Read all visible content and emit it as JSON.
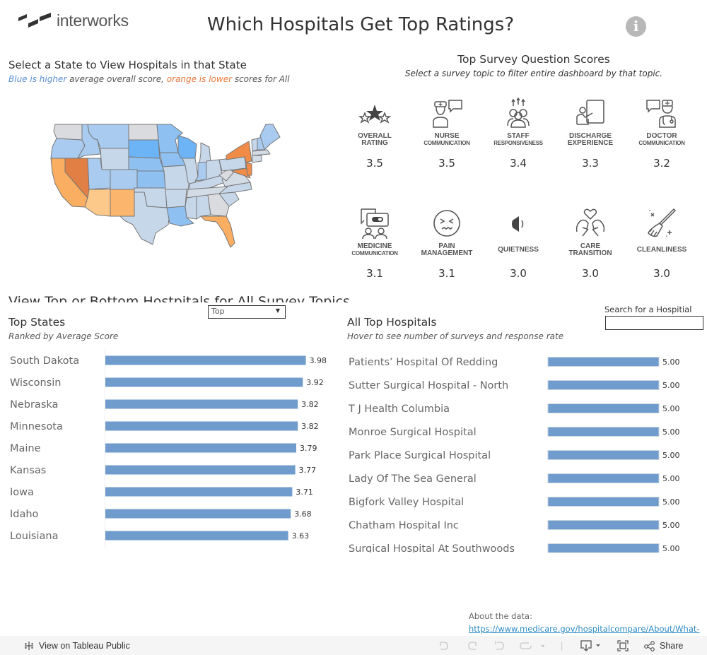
{
  "header": {
    "logo_text": "interworks",
    "title": "Which Hospitals Get Top Ratings?",
    "info_icon": "info-circle-icon"
  },
  "map_section": {
    "title": "Select a State to View Hospitals in that State",
    "legend_blue": "Blue is higher",
    "legend_mid": " average overall score, ",
    "legend_orange": "orange is lower",
    "legend_end": " scores for  All",
    "colors": {
      "highest": "#6db4f7",
      "high": "#8fc0f2",
      "mid_high": "#a9cbf0",
      "neutral": "#c7d7ea",
      "no_data": "#d9dbdf",
      "low": "#fcc98a",
      "lower": "#f9ae62",
      "lowest": "#e27f45",
      "border": "#777777"
    }
  },
  "survey_scores": {
    "title": "Top Survey Question Scores",
    "subtitle": "Select a survey topic to filter entire dashboard by that topic.",
    "topics": [
      {
        "line1": "OVERALL",
        "line2": "RATING",
        "big2": true,
        "score": "3.5",
        "icon": "stars-icon"
      },
      {
        "line1": "NURSE",
        "line2": "COMMUNICATION",
        "big2": false,
        "score": "3.5",
        "icon": "nurse-chat-icon"
      },
      {
        "line1": "STAFF",
        "line2": "RESPONSIVENESS",
        "big2": false,
        "score": "3.4",
        "icon": "staff-arrows-icon"
      },
      {
        "line1": "DISCHARGE",
        "line2": "EXPERIENCE",
        "big2": true,
        "score": "3.3",
        "icon": "discharge-board-icon"
      },
      {
        "line1": "DOCTOR",
        "line2": "COMMUNICATION",
        "big2": false,
        "score": "3.2",
        "icon": "doctor-chat-icon"
      },
      {
        "line1": "MEDICINE",
        "line2": "COMMUNICATION",
        "big2": false,
        "score": "3.1",
        "icon": "medicine-chat-icon"
      },
      {
        "line1": "PAIN",
        "line2": "MANAGEMENT",
        "big2": true,
        "score": "3.1",
        "icon": "pain-face-icon"
      },
      {
        "line1": "",
        "line2": "QUIETNESS",
        "big2": true,
        "score": "3.0",
        "icon": "speaker-quiet-icon"
      },
      {
        "line1": "CARE",
        "line2": "TRANSITION",
        "big2": true,
        "score": "3.0",
        "icon": "care-hands-heart-icon"
      },
      {
        "line1": "",
        "line2": "CLEANLINESS",
        "big2": true,
        "score": "3.0",
        "icon": "broom-icon"
      }
    ]
  },
  "controls": {
    "view_title": "View Top or Bottom Hostpitals for All Survey Topics",
    "dropdown_value": "Top",
    "search_label": "Search for a Hospitial",
    "search_value": ""
  },
  "chart_data": [
    {
      "type": "bar",
      "orientation": "horizontal",
      "title": "Top States",
      "subtitle": "Ranked by Average Score",
      "categories": [
        "South Dakota",
        "Wisconsin",
        "Nebraska",
        "Minnesota",
        "Maine",
        "Kansas",
        "Iowa",
        "Idaho",
        "Louisiana"
      ],
      "values": [
        3.98,
        3.92,
        3.82,
        3.82,
        3.79,
        3.77,
        3.71,
        3.68,
        3.63
      ],
      "value_labels": [
        "3.98",
        "3.92",
        "3.82",
        "3.82",
        "3.79",
        "3.77",
        "3.71",
        "3.68",
        "3.63"
      ],
      "xlim": [
        0,
        4.0
      ],
      "bar_color": "#6f9ccc",
      "grid": false
    },
    {
      "type": "bar",
      "orientation": "horizontal",
      "title": "All Top Hospitals",
      "subtitle": "Hover to see number of surveys and response rate",
      "categories": [
        "Patients’ Hospital Of Redding",
        "Sutter Surgical Hospital - North",
        "T J Health Columbia",
        "Monroe Surgical Hospital",
        "Park Place Surgical Hospital",
        "Lady Of The Sea General",
        "Bigfork Valley Hospital",
        "Chatham Hospital Inc",
        "Surgical Hospital At Southwoods"
      ],
      "values": [
        5.0,
        5.0,
        5.0,
        5.0,
        5.0,
        5.0,
        5.0,
        5.0,
        5.0
      ],
      "value_labels": [
        "5.00",
        "5.00",
        "5.00",
        "5.00",
        "5.00",
        "5.00",
        "5.00",
        "5.00",
        "5.00"
      ],
      "xlim": [
        0,
        5.0
      ],
      "bar_color": "#6f9ccc",
      "grid": false
    }
  ],
  "footer": {
    "about_label": "About the data:",
    "about_link": "https://www.medicare.gov/hospitalcompare/About/What-",
    "view_on_tableau": "View on Tableau Public",
    "share_label": "Share"
  }
}
